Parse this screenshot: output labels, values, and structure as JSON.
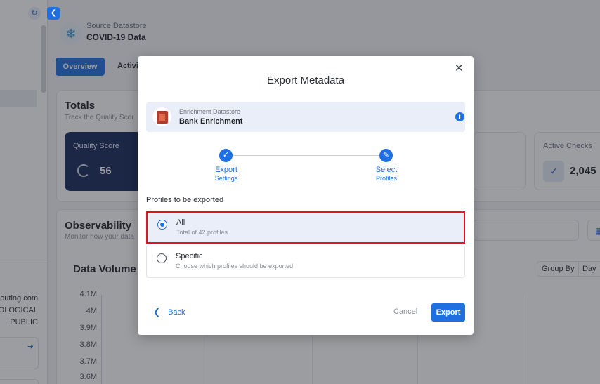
{
  "sidebar": {
    "refresh_icon": "refresh-icon",
    "collapse_icon": "chevron-left-icon",
    "texts": [
      "outing.com",
      "IOLOGICAL",
      "PUBLIC"
    ]
  },
  "header": {
    "datastore_label": "Source Datastore",
    "datastore_name": "COVID-19 Data"
  },
  "tabs": {
    "overview": "Overview",
    "activity": "Activi"
  },
  "totals": {
    "title": "Totals",
    "subtitle": "Track the Quality Scor",
    "quality_score_label": "Quality Score",
    "quality_score_value": "56",
    "active_checks_label": "Active Checks",
    "active_checks_value": "2,045"
  },
  "observability": {
    "title": "Observability",
    "subtitle": "Monitor how your data",
    "data_volume_title": "Data Volume",
    "group_by_label": "Group By",
    "group_by_value": "Day",
    "y_ticks": [
      "4.1M",
      "4M",
      "3.9M",
      "3.8M",
      "3.7M",
      "3.6M"
    ]
  },
  "modal": {
    "title": "Export Metadata",
    "datastore": {
      "type_label": "Enrichment Datastore",
      "name": "Bank Enrichment"
    },
    "steps": [
      {
        "label": "Export",
        "sub": "Settings"
      },
      {
        "label": "Select",
        "sub": "Profiles"
      }
    ],
    "profiles_title": "Profiles to be exported",
    "options": [
      {
        "label": "All",
        "description": "Total of 42 profiles",
        "selected": true
      },
      {
        "label": "Specific",
        "description": "Choose which profiles should be exported",
        "selected": false
      }
    ],
    "back_label": "Back",
    "cancel_label": "Cancel",
    "export_label": "Export"
  },
  "colors": {
    "accent": "#1f6fe0",
    "highlight_border": "#e1141b",
    "quality_card": "#14285a"
  }
}
